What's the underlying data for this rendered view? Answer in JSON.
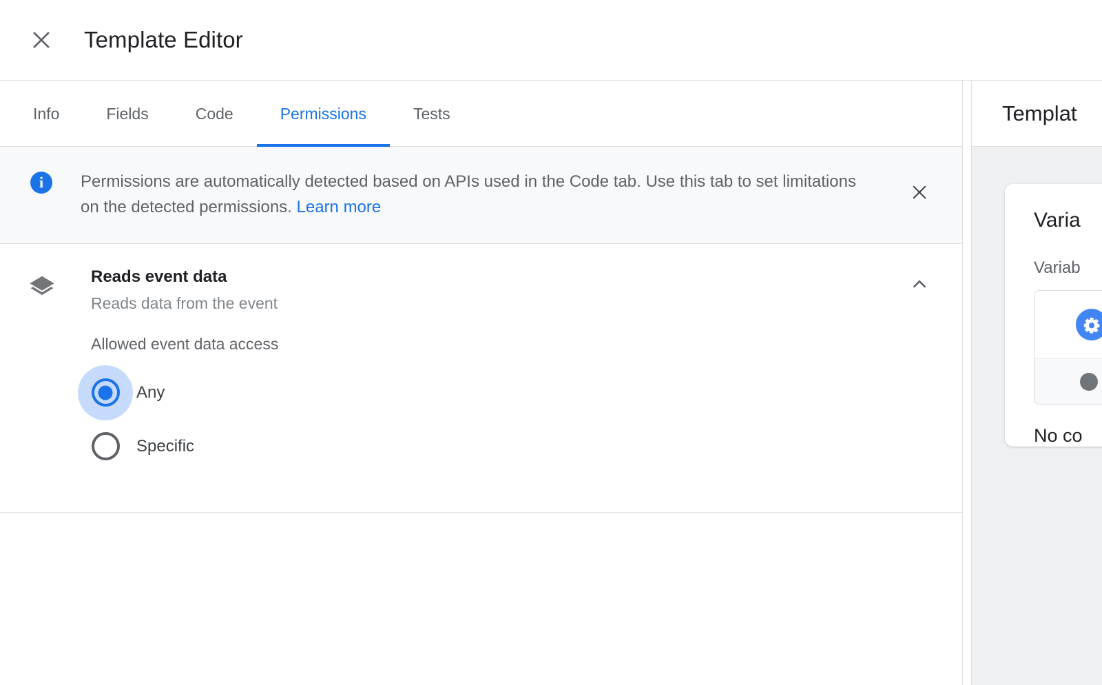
{
  "header": {
    "title": "Template Editor",
    "close_icon": "close-icon"
  },
  "tabs": [
    {
      "label": "Info",
      "active": false
    },
    {
      "label": "Fields",
      "active": false
    },
    {
      "label": "Code",
      "active": false
    },
    {
      "label": "Permissions",
      "active": true
    },
    {
      "label": "Tests",
      "active": false
    }
  ],
  "info_banner": {
    "icon": "info-icon",
    "text": "Permissions are automatically detected based on APIs used in the Code tab. Use this tab to set limitations on the detected permissions.",
    "link_label": "Learn more",
    "close_icon": "close-icon",
    "background": "#f8f9fa",
    "accent": "#1a73e8"
  },
  "permission": {
    "icon": "layers-icon",
    "title": "Reads event data",
    "subtitle": "Reads data from the event",
    "toggle_icon": "chevron-up-icon",
    "expanded": true,
    "field_label": "Allowed event data access",
    "options": [
      {
        "label": "Any",
        "selected": true
      },
      {
        "label": "Specific",
        "selected": false
      }
    ]
  },
  "preview_pane": {
    "header_title": "Templat",
    "card_title": "Varia",
    "card_subtitle": "Variab",
    "blue_icon": "variable-icon",
    "gray_icon": "dot-icon",
    "footer_text": "No co"
  },
  "colors": {
    "accent_blue": "#1a73e8",
    "ripple_blue": "#c6dafc",
    "text_primary": "#202124",
    "text_secondary": "#5f6368",
    "text_muted": "#80868b",
    "divider": "#e0e0e0",
    "panel_bg": "#eef0f1"
  }
}
